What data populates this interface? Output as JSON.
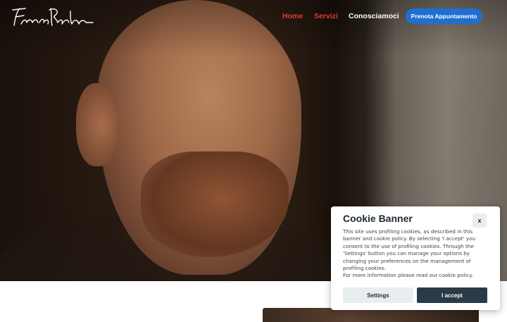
{
  "nav": {
    "logo": "FrancoPaolo",
    "items": [
      {
        "label": "Home",
        "active": true
      },
      {
        "label": "Servizi",
        "active": true
      },
      {
        "label": "Conosciamoci",
        "active": false
      }
    ],
    "cta_label": "Prenota Appuntamento"
  },
  "hero": {
    "image": "man-profile-photo"
  },
  "cookie_banner": {
    "title": "Cookie Banner",
    "close_label": "x",
    "body": "This site uses profiling cookies, as described in this banner and cookie policy. By selecting 'I accept' you consent to the use of profiling cookies. Through the 'Settings' button you can manage your options by changing your preferences on the management of profiling cookies.\nFor more information please read our cookie policy.",
    "settings_label": "Settings",
    "accept_label": "I accept"
  },
  "colors": {
    "accent_red": "#e63a2e",
    "cta_blue": "#1f6fd1",
    "dark_button": "#2a3b47"
  }
}
